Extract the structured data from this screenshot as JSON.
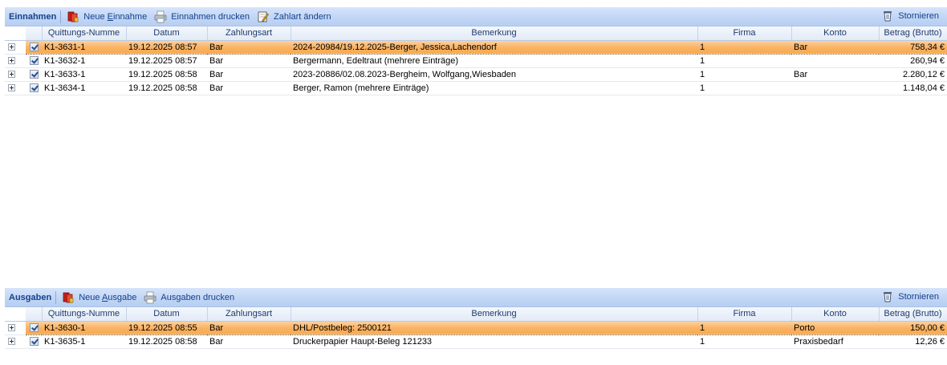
{
  "einnahmen": {
    "toolbar": {
      "title": "Einnahmen",
      "new_pre": "Neue ",
      "new_key": "E",
      "new_post": "innahme",
      "print_label": "Einnahmen drucken",
      "zahlart_label": "Zahlart ändern",
      "storno_label": "Stornieren"
    },
    "columns": [
      "Quittungs-Numme",
      "Datum",
      "Zahlungsart",
      "Bemerkung",
      "Firma",
      "Konto",
      "Betrag (Brutto)"
    ],
    "rows": [
      {
        "nummer": "K1-3631-1",
        "datum": "19.12.2025 08:57",
        "zahlungsart": "Bar",
        "bemerkung": "2024-20984/19.12.2025-Berger, Jessica,Lachendorf",
        "firma": "1",
        "konto": "Bar",
        "betrag": "758,34 €",
        "checked": true,
        "selected": true
      },
      {
        "nummer": "K1-3632-1",
        "datum": "19.12.2025 08:57",
        "zahlungsart": "Bar",
        "bemerkung": "Bergermann, Edeltraut (mehrere Einträge)",
        "firma": "1",
        "konto": "",
        "betrag": "260,94 €",
        "checked": true,
        "selected": false
      },
      {
        "nummer": "K1-3633-1",
        "datum": "19.12.2025 08:58",
        "zahlungsart": "Bar",
        "bemerkung": "2023-20886/02.08.2023-Bergheim, Wolfgang,Wiesbaden",
        "firma": "1",
        "konto": "Bar",
        "betrag": "2.280,12 €",
        "checked": true,
        "selected": false
      },
      {
        "nummer": "K1-3634-1",
        "datum": "19.12.2025 08:58",
        "zahlungsart": "Bar",
        "bemerkung": "Berger, Ramon (mehrere Einträge)",
        "firma": "1",
        "konto": "",
        "betrag": "1.148,04 €",
        "checked": true,
        "selected": false
      }
    ]
  },
  "ausgaben": {
    "toolbar": {
      "title": "Ausgaben",
      "new_pre": "Neue ",
      "new_key": "A",
      "new_post": "usgabe",
      "print_label": "Ausgaben drucken",
      "storno_label": "Stornieren"
    },
    "columns": [
      "Quittungs-Numme",
      "Datum",
      "Zahlungsart",
      "Bemerkung",
      "Firma",
      "Konto",
      "Betrag (Brutto)"
    ],
    "rows": [
      {
        "nummer": "K1-3630-1",
        "datum": "19.12.2025 08:55",
        "zahlungsart": "Bar",
        "bemerkung": "DHL/Postbeleg: 2500121",
        "firma": "1",
        "konto": "Porto",
        "betrag": "150,00 €",
        "checked": true,
        "selected": true
      },
      {
        "nummer": "K1-3635-1",
        "datum": "19.12.2025 08:58",
        "zahlungsart": "Bar",
        "bemerkung": "Druckerpapier Haupt-Beleg 121233",
        "firma": "1",
        "konto": "Praxisbedarf",
        "betrag": "12,26 €",
        "checked": true,
        "selected": false
      }
    ]
  },
  "colors": {
    "toolbar_text": "#15428b",
    "selection": "#f9b263",
    "header_bg": "#e2eaf6"
  },
  "icons": {
    "new": "red-book-icon",
    "print": "printer-icon",
    "zahlart": "edit-note-icon",
    "storno": "trash-icon"
  }
}
